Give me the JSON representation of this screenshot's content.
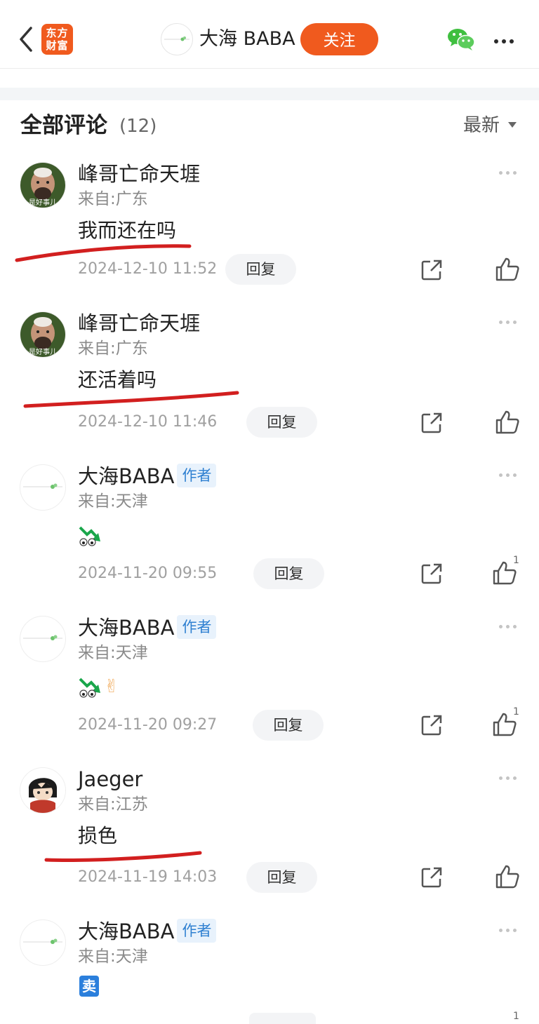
{
  "header": {
    "logo_line1": "东方",
    "logo_line2": "财富",
    "author_name": "大海 BABA",
    "follow_label": "关注"
  },
  "comments_section": {
    "title": "全部评论",
    "count": "(12)",
    "sort_label": "最新"
  },
  "comments": [
    {
      "name": "峰哥亡命天堐",
      "location": "来自:广东",
      "text": "我而还在吗",
      "time": "2024-12-10 11:52",
      "reply_label": "回复",
      "likes": ""
    },
    {
      "name": "峰哥亡命天堐",
      "location": "来自:广东",
      "text": "还活着吗",
      "time": "2024-12-10 11:46",
      "reply_label": "回复",
      "likes": ""
    },
    {
      "name": "大海BABA",
      "badge": "作者",
      "location": "来自:天津",
      "text": "",
      "time": "2024-11-20 09:55",
      "reply_label": "回复",
      "likes": "1"
    },
    {
      "name": "大海BABA",
      "badge": "作者",
      "location": "来自:天津",
      "text": "",
      "time": "2024-11-20 09:27",
      "reply_label": "回复",
      "likes": "1"
    },
    {
      "name": "Jaeger",
      "location": "来自:江苏",
      "text": "损色",
      "time": "2024-11-19 14:03",
      "reply_label": "回复",
      "likes": ""
    },
    {
      "name": "大海BABA",
      "badge": "作者",
      "location": "来自:天津",
      "text": "",
      "time": "",
      "reply_label": "",
      "likes": "1"
    }
  ],
  "avatar_lettering": {
    "feng": "是好事儿"
  },
  "emoji_text": {
    "sell": "卖",
    "victory": "✌"
  },
  "colors": {
    "brand": "#f05a1e",
    "badge_blue": "#2f80d1",
    "annotation_red": "#d21f1f",
    "wechat_green": "#3fbf3f"
  },
  "icons": {
    "back": "chevron-left-icon",
    "wechat": "wechat-icon",
    "more": "more-dots-icon",
    "share": "share-icon",
    "like": "thumbs-up-icon"
  }
}
